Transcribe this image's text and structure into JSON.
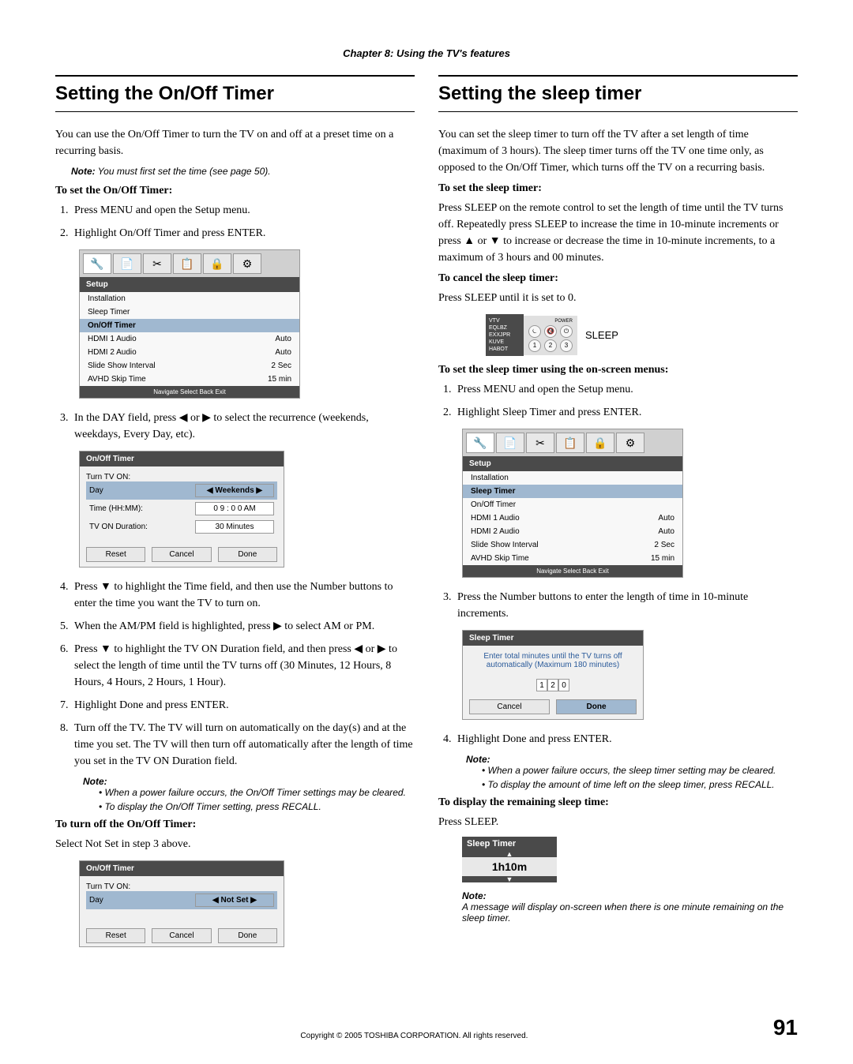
{
  "chapter": "Chapter 8: Using the TV's features",
  "left": {
    "title": "Setting the On/Off Timer",
    "intro": "You can use the On/Off Timer to turn the TV on and off at a preset time on a recurring basis.",
    "note1_label": "Note:",
    "note1": "You must first set the time (see page 50).",
    "heading1": "To set the On/Off Timer:",
    "steps1": [
      "Press MENU and open the Setup menu.",
      "Highlight On/Off Timer and press ENTER."
    ],
    "menu1": {
      "title": "Setup",
      "items": [
        {
          "label": "Installation",
          "value": ""
        },
        {
          "label": "Sleep Timer",
          "value": ""
        },
        {
          "label": "On/Off Timer",
          "value": "",
          "highlighted": true
        },
        {
          "label": "HDMI 1 Audio",
          "value": "Auto"
        },
        {
          "label": "HDMI 2 Audio",
          "value": "Auto"
        },
        {
          "label": "Slide Show Interval",
          "value": "2 Sec"
        },
        {
          "label": "AVHD Skip Time",
          "value": "15 min"
        }
      ],
      "footer": "Navigate    Select    Back    Exit"
    },
    "step3": "In the DAY field, press ◀ or ▶ to select the recurrence (weekends, weekdays, Every Day, etc).",
    "dialog1": {
      "title": "On/Off Timer",
      "subtitle": "Turn TV ON:",
      "rows": [
        {
          "label": "Day",
          "value": "◀    Weekends    ▶",
          "highlighted": true
        },
        {
          "label": "Time (HH:MM):",
          "value": "0 9 : 0 0  AM"
        },
        {
          "label": "TV ON Duration:",
          "value": "30 Minutes"
        }
      ],
      "buttons": [
        "Reset",
        "Cancel",
        "Done"
      ]
    },
    "step4": "Press ▼ to highlight the Time field, and then use the Number buttons to enter the time you want the TV to turn on.",
    "step5": "When the AM/PM field is highlighted, press ▶ to select AM or PM.",
    "step6": "Press ▼ to highlight the TV ON Duration field, and then press ◀ or ▶ to select the length of time until the TV turns off (30 Minutes, 12 Hours, 8 Hours, 4 Hours, 2 Hours, 1 Hour).",
    "step7": "Highlight Done and press ENTER.",
    "step8": "Turn off the TV. The TV will turn on automatically on the day(s) and at the time you set. The TV will then turn off automatically after the length of time you set in the TV ON Duration field.",
    "note2_label": "Note:",
    "note2_bullets": [
      "When a power failure occurs, the On/Off Timer settings may be cleared.",
      "To display the On/Off Timer setting, press RECALL."
    ],
    "heading2": "To turn off the On/Off Timer:",
    "turnoff_text": "Select Not Set in step 3 above.",
    "dialog2": {
      "title": "On/Off Timer",
      "subtitle": "Turn TV ON:",
      "rows": [
        {
          "label": "Day",
          "value": "◀    Not Set    ▶",
          "highlighted": true
        }
      ],
      "buttons": [
        "Reset",
        "Cancel",
        "Done"
      ]
    }
  },
  "right": {
    "title": "Setting the sleep timer",
    "intro": "You can set the sleep timer to turn off the TV after a set length of time (maximum of 3 hours). The sleep timer turns off the TV one time only, as opposed to the On/Off Timer, which turns off the TV on a recurring basis.",
    "heading1": "To set the sleep timer:",
    "text1": "Press SLEEP on the remote control to set the length of time until the TV turns off. Repeatedly press SLEEP to increase the time in 10-minute increments or press ▲ or ▼ to increase or decrease the time in 10-minute increments, to a maximum of 3 hours and 00 minutes.",
    "heading2": "To cancel the sleep timer:",
    "text2": "Press SLEEP until it is set to 0.",
    "remote": {
      "lines": [
        "VTV",
        "EQLBZ",
        "EXXJPR",
        "KUVE",
        "HABOT"
      ],
      "power": "POWER",
      "label": "SLEEP"
    },
    "heading3": "To set the sleep timer using the on-screen menus:",
    "steps3": [
      "Press MENU and open the Setup menu.",
      "Highlight Sleep Timer and press ENTER."
    ],
    "menu2": {
      "title": "Setup",
      "items": [
        {
          "label": "Installation",
          "value": ""
        },
        {
          "label": "Sleep Timer",
          "value": "",
          "highlighted": true
        },
        {
          "label": "On/Off Timer",
          "value": ""
        },
        {
          "label": "HDMI 1 Audio",
          "value": "Auto"
        },
        {
          "label": "HDMI 2 Audio",
          "value": "Auto"
        },
        {
          "label": "Slide Show Interval",
          "value": "2 Sec"
        },
        {
          "label": "AVHD Skip Time",
          "value": "15 min"
        }
      ],
      "footer": "Navigate    Select    Back    Exit"
    },
    "step3b": "Press the Number buttons to enter the length of time in 10-minute increments.",
    "dialog3": {
      "title": "Sleep Timer",
      "message": "Enter total minutes until the TV turns off automatically (Maximum 180 minutes)",
      "digits": [
        "1",
        "2",
        "0"
      ],
      "buttons": [
        "Cancel",
        "Done"
      ]
    },
    "step4b": "Highlight Done and press ENTER.",
    "note3_label": "Note:",
    "note3_bullets": [
      "When a power failure occurs, the sleep timer setting may be cleared.",
      "To display the amount of time left on the sleep timer, press RECALL."
    ],
    "heading4": "To display the remaining sleep time:",
    "text4": "Press SLEEP.",
    "sleep_small": {
      "title": "Sleep Timer",
      "time": "1h10m"
    },
    "note4_label": "Note:",
    "note4": "A message will display on-screen when there is one minute remaining on the sleep timer."
  },
  "footer": {
    "copyright": "Copyright © 2005 TOSHIBA CORPORATION. All rights reserved.",
    "page": "91"
  }
}
